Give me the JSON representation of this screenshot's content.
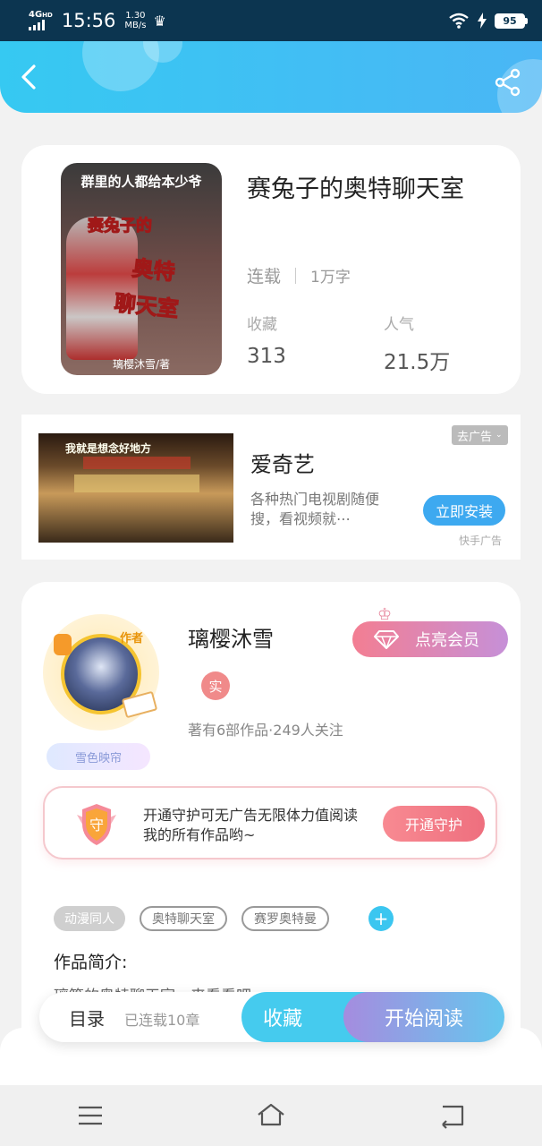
{
  "status_bar": {
    "network": "4G",
    "network_sup": "HD",
    "time": "15:56",
    "speed_value": "1.30",
    "speed_unit": "MB/s",
    "battery": "95",
    "icons": [
      "signal-icon",
      "crown-icon",
      "wifi-icon",
      "charging-icon",
      "battery-icon"
    ]
  },
  "header": {
    "back_icon": "chevron-left-icon",
    "share_icon": "share-icon",
    "accent": "#3ec6f2"
  },
  "book": {
    "title": "赛兔子的奥特聊天室",
    "status": "连载",
    "word_count": "1万字",
    "collect_label": "收藏",
    "collect_value": "313",
    "popularity_label": "人气",
    "popularity_value": "21.5万",
    "cover": {
      "top_text": "群里的人都给本少爷",
      "title_line1": "赛兔子的",
      "title_line2": "奥特",
      "title_line3": "聊天室",
      "author": "璃樱沐雪/著"
    }
  },
  "ad": {
    "title": "爱奇艺",
    "description": "各种热门电视剧随便搜，看视频就⋯",
    "close_label": "去广告",
    "install_label": "立即安装",
    "source": "快手广告",
    "image_text": "我就是想念好地方"
  },
  "author": {
    "name": "璃樱沐雪",
    "badge_tag": "作者",
    "verified_label": "实",
    "stats": "著有6部作品·249人关注",
    "nickname_badge": "雪色映帘",
    "vip_label": "点亮会员"
  },
  "guard": {
    "icon_text": "守",
    "text": "开通守护可无广告无限体力值阅读我的所有作品哟~",
    "button_label": "开通守护"
  },
  "tags": {
    "items": [
      "动漫同人",
      "奥特聊天室",
      "赛罗奥特曼"
    ],
    "add_label": "+"
  },
  "intro": {
    "heading": "作品简介:",
    "text": "璃筱的奥特聊天室，来看看吧"
  },
  "action_bar": {
    "toc_label": "目录",
    "chapters_label": "已连载10章",
    "favorite_label": "收藏",
    "read_label": "开始阅读"
  },
  "navbar": {
    "icons": [
      "menu-icon",
      "home-icon",
      "back-icon"
    ]
  }
}
